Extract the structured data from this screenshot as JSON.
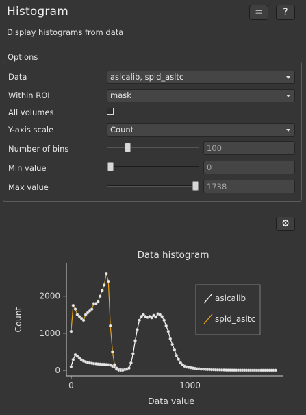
{
  "header": {
    "title": "Histogram",
    "subtitle": "Display histograms from data",
    "menu_icon": "≡",
    "help_label": "?"
  },
  "options": {
    "legend": "Options",
    "data_label": "Data",
    "data_value": "aslcalib, spld_asltc",
    "roi_label": "Within ROI",
    "roi_value": "mask",
    "all_volumes_label": "All volumes",
    "all_volumes_checked": false,
    "yscale_label": "Y-axis scale",
    "yscale_value": "Count",
    "bins_label": "Number of bins",
    "bins_value": "100",
    "bins_slider_fraction": 0.2,
    "min_label": "Min value",
    "min_value": "0",
    "min_slider_fraction": 0.0,
    "max_label": "Max value",
    "max_value": "1738",
    "max_slider_fraction": 1.0
  },
  "plot_options_icon": "gear-icon",
  "chart_data": {
    "type": "line",
    "title": "Data histogram",
    "xlabel": "Data value",
    "ylabel": "Count",
    "xlim": [
      -40,
      1780
    ],
    "ylim": [
      -150,
      2900
    ],
    "xticks": [
      0,
      1000
    ],
    "yticks": [
      0,
      1000,
      2000
    ],
    "legend_position": "top-right",
    "series": [
      {
        "name": "aslcalib",
        "color": "#ffffff",
        "points": [
          [
            0,
            100
          ],
          [
            17,
            290
          ],
          [
            35,
            420
          ],
          [
            52,
            380
          ],
          [
            70,
            330
          ],
          [
            87,
            280
          ],
          [
            104,
            250
          ],
          [
            122,
            230
          ],
          [
            139,
            210
          ],
          [
            156,
            200
          ],
          [
            174,
            190
          ],
          [
            191,
            180
          ],
          [
            209,
            175
          ],
          [
            226,
            170
          ],
          [
            243,
            165
          ],
          [
            261,
            160
          ],
          [
            278,
            160
          ],
          [
            296,
            155
          ],
          [
            313,
            150
          ],
          [
            330,
            140
          ],
          [
            348,
            110
          ],
          [
            365,
            90
          ],
          [
            382,
            60
          ],
          [
            400,
            30
          ],
          [
            417,
            20
          ],
          [
            434,
            15
          ],
          [
            452,
            20
          ],
          [
            469,
            30
          ],
          [
            487,
            60
          ],
          [
            504,
            200
          ],
          [
            521,
            450
          ],
          [
            539,
            800
          ],
          [
            556,
            1100
          ],
          [
            574,
            1350
          ],
          [
            591,
            1450
          ],
          [
            608,
            1500
          ],
          [
            626,
            1450
          ],
          [
            643,
            1430
          ],
          [
            660,
            1450
          ],
          [
            678,
            1420
          ],
          [
            695,
            1480
          ],
          [
            712,
            1440
          ],
          [
            730,
            1520
          ],
          [
            747,
            1500
          ],
          [
            764,
            1450
          ],
          [
            782,
            1350
          ],
          [
            799,
            1200
          ],
          [
            817,
            1050
          ],
          [
            834,
            850
          ],
          [
            851,
            700
          ],
          [
            869,
            550
          ],
          [
            886,
            400
          ],
          [
            903,
            300
          ],
          [
            921,
            200
          ],
          [
            938,
            150
          ],
          [
            955,
            110
          ],
          [
            973,
            90
          ],
          [
            990,
            80
          ],
          [
            1008,
            70
          ],
          [
            1025,
            60
          ],
          [
            1042,
            50
          ],
          [
            1060,
            40
          ],
          [
            1077,
            40
          ],
          [
            1094,
            30
          ],
          [
            1112,
            30
          ],
          [
            1129,
            25
          ],
          [
            1146,
            20
          ],
          [
            1164,
            20
          ],
          [
            1181,
            15
          ],
          [
            1199,
            15
          ],
          [
            1216,
            12
          ],
          [
            1233,
            10
          ],
          [
            1251,
            10
          ],
          [
            1268,
            8
          ],
          [
            1285,
            8
          ],
          [
            1303,
            6
          ],
          [
            1320,
            5
          ],
          [
            1338,
            5
          ],
          [
            1355,
            4
          ],
          [
            1372,
            4
          ],
          [
            1390,
            3
          ],
          [
            1407,
            3
          ],
          [
            1424,
            2
          ],
          [
            1442,
            2
          ],
          [
            1459,
            2
          ],
          [
            1476,
            1
          ],
          [
            1494,
            1
          ],
          [
            1511,
            1
          ],
          [
            1529,
            1
          ],
          [
            1546,
            1
          ],
          [
            1563,
            0
          ],
          [
            1581,
            0
          ],
          [
            1598,
            0
          ],
          [
            1615,
            0
          ],
          [
            1633,
            0
          ],
          [
            1650,
            0
          ],
          [
            1668,
            0
          ],
          [
            1685,
            0
          ],
          [
            1702,
            0
          ],
          [
            1720,
            0
          ]
        ]
      },
      {
        "name": "spld_asltc",
        "color": "#e8a317",
        "points": [
          [
            0,
            1050
          ],
          [
            17,
            1750
          ],
          [
            35,
            1650
          ],
          [
            52,
            1500
          ],
          [
            70,
            1450
          ],
          [
            87,
            1400
          ],
          [
            104,
            1350
          ],
          [
            122,
            1500
          ],
          [
            139,
            1550
          ],
          [
            156,
            1600
          ],
          [
            174,
            1650
          ],
          [
            191,
            1800
          ],
          [
            209,
            1800
          ],
          [
            226,
            1850
          ],
          [
            243,
            2000
          ],
          [
            261,
            2150
          ],
          [
            278,
            2300
          ],
          [
            296,
            2600
          ],
          [
            313,
            2400
          ],
          [
            330,
            1200
          ],
          [
            348,
            500
          ],
          [
            365,
            150
          ],
          [
            382,
            30
          ],
          [
            400,
            5
          ],
          [
            417,
            0
          ],
          [
            434,
            0
          ]
        ]
      }
    ]
  }
}
